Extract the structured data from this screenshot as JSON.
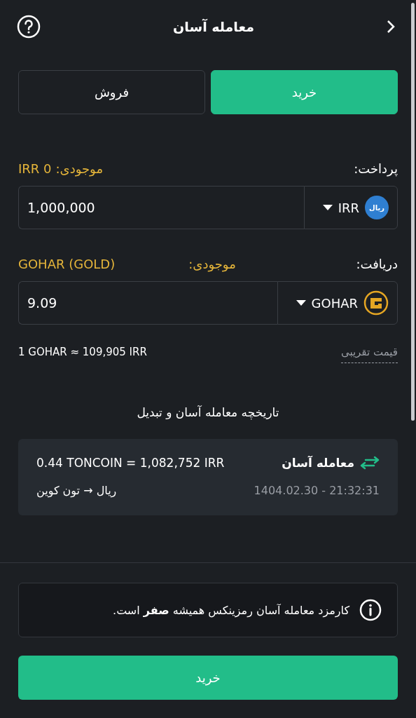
{
  "header": {
    "title": "معامله آسان"
  },
  "tabs": [
    {
      "label": "خرید",
      "selected": true
    },
    {
      "label": "فروش",
      "selected": false
    }
  ],
  "sections": [
    {
      "label": "پرداخت:",
      "balance_label": "موجودی:",
      "balance_value": "IRR 0",
      "currency": "IRR",
      "kind": "rial",
      "icon_text": "ریال",
      "value": "1,000,000"
    },
    {
      "label": "دریافت:",
      "balance_label": "موجودی:",
      "balance_value": "GOHAR (GOLD)",
      "currency": "GOHAR",
      "kind": "gohar",
      "value": "9.09"
    }
  ],
  "rate": {
    "label": "قیمت تقریبی",
    "value": "1 GOHAR ≈ 109,905 IRR"
  },
  "history": {
    "title": "تاریخچه معامله آسان و تبدیل",
    "items": [
      {
        "type": "معامله آسان",
        "amount": "0.44 TONCOIN = 1,082,752 IRR",
        "route": "ریال → تون کوین",
        "time": "1404.02.30 - 21:32:31"
      }
    ]
  },
  "notice": "کارمزد معامله آسان رمزینکس همیشه **صفر** است.",
  "submit": "خرید"
}
